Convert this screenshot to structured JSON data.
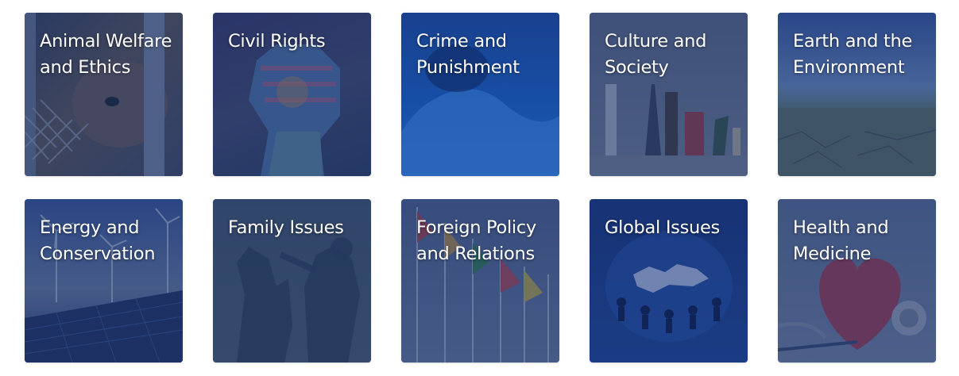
{
  "topics": [
    {
      "label": "Animal Welfare and Ethics",
      "icon": "animal-welfare-image"
    },
    {
      "label": "Civil Rights",
      "icon": "raised-fist-image"
    },
    {
      "label": "Crime and Punishment",
      "icon": "crime-image"
    },
    {
      "label": "Culture and Society",
      "icon": "world-landmarks-image"
    },
    {
      "label": "Earth and the Environment",
      "icon": "landscape-image"
    },
    {
      "label": "Energy and Conservation",
      "icon": "wind-turbines-solar-image"
    },
    {
      "label": "Family Issues",
      "icon": "family-shadows-image"
    },
    {
      "label": "Foreign Policy and Relations",
      "icon": "flags-image"
    },
    {
      "label": "Global Issues",
      "icon": "globe-people-image"
    },
    {
      "label": "Health and Medicine",
      "icon": "heart-stethoscope-image"
    }
  ],
  "colors": {
    "overlay": "#1c346e",
    "text": "#ffffff"
  }
}
